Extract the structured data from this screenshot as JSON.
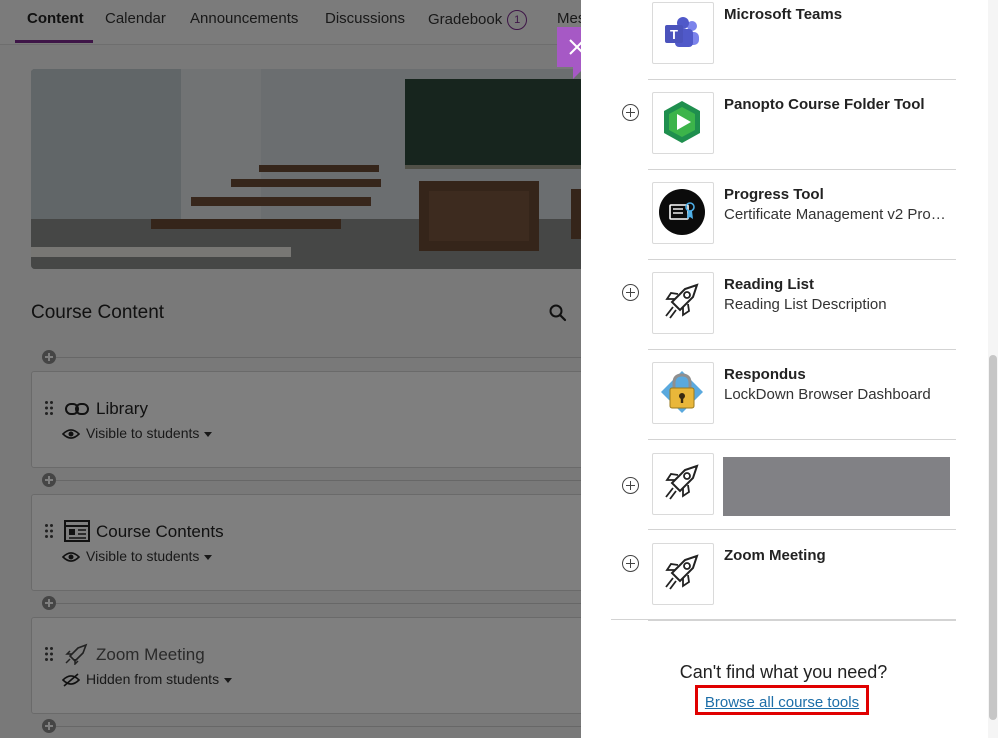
{
  "nav": {
    "tabs": [
      {
        "label": "Content"
      },
      {
        "label": "Calendar"
      },
      {
        "label": "Announcements"
      },
      {
        "label": "Discussions"
      },
      {
        "label": "Gradebook",
        "badge": "1"
      },
      {
        "label": "Mes"
      }
    ]
  },
  "course": {
    "section_title": "Course Content",
    "items": [
      {
        "title": "Library",
        "visibility": "Visible to students"
      },
      {
        "title": "Course Contents",
        "visibility": "Visible to students"
      },
      {
        "title": "Zoom Meeting",
        "visibility": "Hidden from students"
      }
    ]
  },
  "panel": {
    "tools": [
      {
        "name": "Microsoft Teams",
        "description": ""
      },
      {
        "name": "Panopto Course Folder Tool",
        "description": ""
      },
      {
        "name": "Progress Tool",
        "description": "Certificate Management v2 Progr..."
      },
      {
        "name": "Reading List",
        "description": "Reading List Description"
      },
      {
        "name": "Respondus",
        "description": "LockDown Browser Dashboard"
      },
      {
        "name": "",
        "description": ""
      },
      {
        "name": "Zoom Meeting",
        "description": ""
      }
    ],
    "help_title": "Can't find what you need?",
    "browse_link": "Browse all course tools"
  },
  "colors": {
    "accent": "#7c2b8f",
    "close_button": "#a659c5",
    "link": "#1d6ea8",
    "highlight": "#e00000"
  },
  "icons": {
    "close": "close-icon",
    "search": "search-icon",
    "eye": "eye-icon",
    "eye_off": "eye-off-icon",
    "link": "link-icon",
    "document": "document-icon",
    "rocket": "rocket-icon",
    "add": "plus-circle-icon"
  }
}
